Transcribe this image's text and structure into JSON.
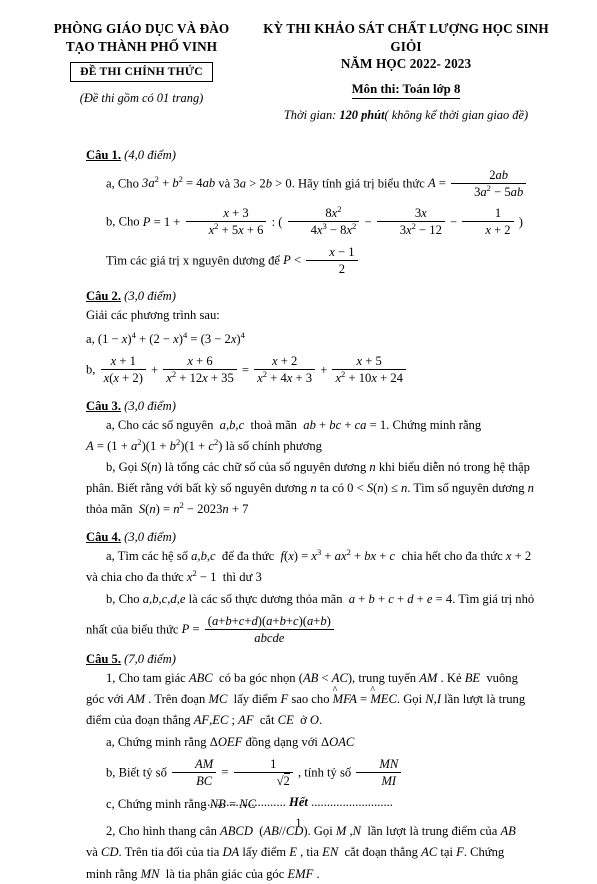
{
  "header": {
    "left_title_line1": "PHÒNG GIÁO DỤC VÀ ĐÀO",
    "left_title_line2": "TẠO THÀNH PHỐ VINH",
    "exam_box_label": "ĐỀ THI CHÍNH THỨC",
    "pages_note": "(Đề thi gồm có 01 trang)",
    "right_title_line1": "KỲ THI KHẢO SÁT CHẤT LƯỢNG HỌC SINH GIỎI",
    "right_title_line2": "NĂM HỌC 2022- 2023",
    "subject": "Môn thi: Toán lớp 8",
    "time_prefix": "Thời gian:",
    "time_value": "120 phút",
    "time_suffix": "( không kể thời gian giao đề)"
  },
  "questions": {
    "q1": {
      "label": "Câu 1.",
      "points": "(4,0 điểm)",
      "a_prefix": "a, Cho",
      "a_cond1": "3a² + b² = 4ab",
      "a_and": "và",
      "a_cond2": "3a > 2b > 0",
      "a_ask": ". Hãy tính giá trị biểu thức",
      "a_expr_lhs": "A =",
      "a_expr_num": "2ab",
      "a_expr_den": "3a² − 5ab",
      "b_prefix": "b, Cho",
      "b_P": "P = 1 +",
      "b_f1_num": "x + 3",
      "b_f1_den": "x² + 5x + 6",
      "b_div": ": (",
      "b_f2_num": "8x²",
      "b_f2_den": "4x³ − 8x²",
      "b_minus1": "−",
      "b_f3_num": "3x",
      "b_f3_den": "3x² − 12",
      "b_minus2": "−",
      "b_f4_num": "1",
      "b_f4_den": "x + 2",
      "b_close": ")",
      "c_text": "Tìm các giá trị x nguyên dương để",
      "c_lt": "P <",
      "c_num": "x − 1",
      "c_den": "2"
    },
    "q2": {
      "label": "Câu 2.",
      "points": "(3,0 điểm)",
      "intro": "Giải các phương trình sau:",
      "a_text": "a, (1 − x)⁴ + (2 − x)⁴ = (3 − 2x)⁴",
      "b_prefix": "b,",
      "b_f1_num": "x + 1",
      "b_f1_den": "x(x + 2)",
      "b_op1": "+",
      "b_f2_num": "x + 6",
      "b_f2_den": "x² + 12x + 35",
      "b_eq": "=",
      "b_f3_num": "x + 2",
      "b_f3_den": "x² + 4x + 3",
      "b_op2": "+",
      "b_f4_num": "x + 5",
      "b_f4_den": "x² + 10x + 24"
    },
    "q3": {
      "label": "Câu 3.",
      "points": "(3,0 điểm)",
      "a_text_1": "a, Cho các số nguyên a,b,c thoả mãn ab + bc + ca = 1 . Chứng minh rằng",
      "a_text_2_lhs": "A = (1 + a²)(1 + b²)(1 + c²)",
      "a_text_2_rhs": "là số chính phương",
      "b_text_1": "b, Gọi S(n) là tổng các chữ số của số nguyên dương n khi biểu diễn nó trong hệ thập",
      "b_text_2": "phân. Biết rằng với bất kỳ số nguyên dương n ta có 0 < S(n) ≤ n . Tìm số nguyên dương n",
      "b_text_3": "thỏa mãn S(n) = n² − 2023n + 7"
    },
    "q4": {
      "label": "Câu 4.",
      "points": "(3,0 điểm)",
      "a_text_1": "a, Tìm các hệ số a,b,c để đa thức f(x) = x³ + ax² + bx + c chia hết cho đa thức x + 2",
      "a_text_2": "và chia cho đa thức x² − 1 thì dư 3",
      "b_text_1": "b, Cho a,b,c,d,e là các số thực dương thỏa mãn a + b + c + d + e = 4 . Tìm giá trị nhỏ",
      "b_text_2": "nhất của biểu thức",
      "b_P": "P =",
      "b_num": "(a + b + c + d)(a + b + c)(a + b)",
      "b_den": "abcde"
    },
    "q5": {
      "label": "Câu 5.",
      "points": "(7,0 điểm)",
      "p1_line1": "1, Cho tam giác ABC có ba góc nhọn (AB < AC), trung tuyến AM . Kẻ BE vuông",
      "p1_line2_a": "góc với AM . Trên đoạn MC lấy điểm F sao cho",
      "p1_line2_ang1": "MFA",
      "p1_line2_eq": "=",
      "p1_line2_ang2": "MEC",
      "p1_line2_b": ". Gọi N,I lần lượt là trung",
      "p1_line3": "điểm của đoạn thẳng AF,EC ; AF cắt CE ở O.",
      "a_text": "a, Chứng minh rằng ΔOEF đồng dạng với ΔOAC",
      "b_prefix": "b, Biết tỷ số",
      "b_f1_num": "AM",
      "b_f1_den": "BC",
      "b_eq": "=",
      "b_f2_num": "1",
      "b_f2_den": "√2",
      "b_mid": ", tính tỷ số",
      "b_f3_num": "MN",
      "b_f3_den": "MI",
      "c_text": "c, Chứng minh rằng NB = NC",
      "p2_line1": "2, Cho hình thang cân ABCD (AB//CD). Gọi M ,N lần lượt là trung điểm của AB",
      "p2_line2": "và CD. Trên tia đối của tia DA lấy điểm E , tia EN cắt đoạn thẳng AC tại F . Chứng",
      "p2_line3": "minh rằng MN là tia phân giác của góc EMF ."
    }
  },
  "footer": {
    "dots_left": "..........................",
    "end_word": "Hết",
    "dots_right": "..........................",
    "page_number": "1"
  }
}
